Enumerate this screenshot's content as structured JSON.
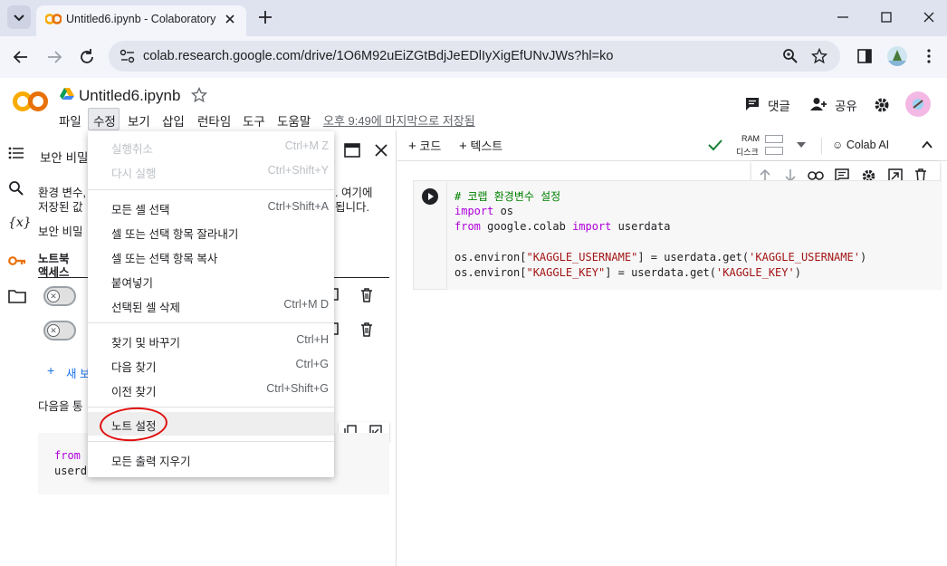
{
  "browser": {
    "tab_title": "Untitled6.ipynb - Colaboratory",
    "url": "colab.research.google.com/drive/1O6M92uEiZGtBdjJeEDlIyXigEfUNvJWs?hl=ko"
  },
  "header": {
    "notebook_title": "Untitled6.ipynb",
    "comment_label": "댓글",
    "share_label": "공유",
    "menus": [
      "파일",
      "수정",
      "보기",
      "삽입",
      "런타임",
      "도구",
      "도움말"
    ],
    "save_status": "오후 9:49에 마지막으로 저장됨"
  },
  "side_panel": {
    "title": "보안 비밀",
    "desc_line1": "환경 변수,",
    "desc_line1_end": ". 여기에",
    "desc_line2": "저장된 값",
    "desc_line2_end": "됩니다.",
    "line3": "보안 비밀",
    "col_notebook": "노트북",
    "col_access": "액세스",
    "add_new": "새 보",
    "usage": "다음을 통",
    "snippet_line1": "from s",
    "snippet_line2": "userda"
  },
  "main_toolbar": {
    "add_code": "코드",
    "add_text": "텍스트",
    "ram_label": "RAM",
    "disk_label": "디스크",
    "colab_ai": "Colab AI"
  },
  "code_cell": {
    "line1": "# 코랩 환경변수 설정",
    "line2_kw": "import",
    "line2_rest": " os",
    "line3_kw1": "from",
    "line3_mid": " google.colab ",
    "line3_kw2": "import",
    "line3_rest": " userdata",
    "line5_a": "os.environ[",
    "line5_str1": "\"KAGGLE_USERNAME\"",
    "line5_b": "] = userdata.get(",
    "line5_str2": "'KAGGLE_USERNAME'",
    "line5_c": ")",
    "line6_a": "os.environ[",
    "line6_str1": "\"KAGGLE_KEY\"",
    "line6_b": "] = userdata.get(",
    "line6_str2": "'KAGGLE_KEY'",
    "line6_c": ")"
  },
  "edit_menu": {
    "undo": "실행취소",
    "undo_sc": "Ctrl+M Z",
    "redo": "다시 실행",
    "redo_sc": "Ctrl+Shift+Y",
    "select_all": "모든 셀 선택",
    "select_all_sc": "Ctrl+Shift+A",
    "cut": "셀 또는 선택 항목 잘라내기",
    "copy": "셀 또는 선택 항목 복사",
    "paste": "붙여넣기",
    "delete": "선택된 셀 삭제",
    "delete_sc": "Ctrl+M D",
    "find_replace": "찾기 및 바꾸기",
    "find_replace_sc": "Ctrl+H",
    "find_next": "다음 찾기",
    "find_next_sc": "Ctrl+G",
    "find_prev": "이전 찾기",
    "find_prev_sc": "Ctrl+Shift+G",
    "notebook_settings": "노트 설정",
    "clear_outputs": "모든 출력 지우기"
  },
  "colors": {
    "colab_orange": "#f9ab00",
    "annotation_red": "#e01010",
    "run_green": "#188038"
  }
}
